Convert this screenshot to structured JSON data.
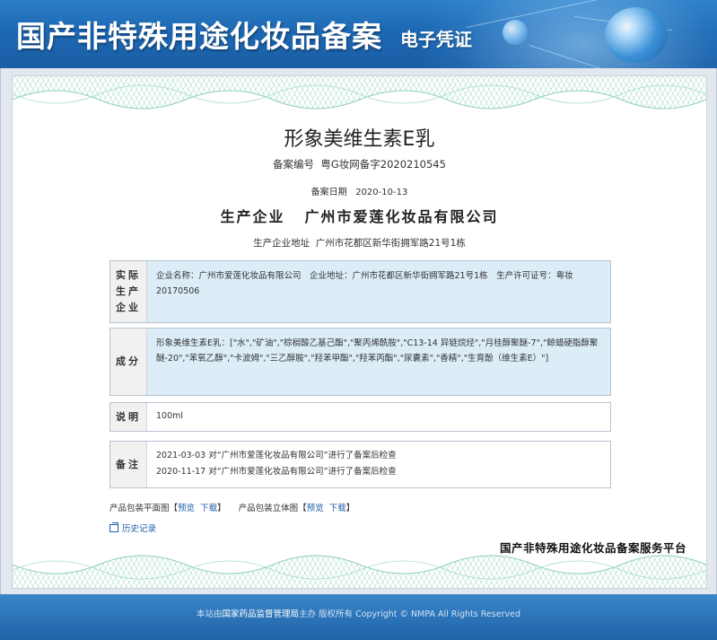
{
  "header": {
    "title": "国产非特殊用途化妆品备案",
    "subtitle": "电子凭证"
  },
  "certificate": {
    "product_name": "形象美维生素E乳",
    "registration_no_label": "备案编号",
    "registration_no": "粤G妆网备字2020210545",
    "registration_date_label": "备案日期",
    "registration_date": "2020-10-13",
    "manufacturer_label": "生产企业",
    "manufacturer": "广州市爱莲化妆品有限公司",
    "manufacturer_address_label": "生产企业地址",
    "manufacturer_address": "广州市花都区新华街拥军路21号1栋"
  },
  "sections": {
    "actual_producer": {
      "label": "实际生产企业",
      "label_lines": [
        "实际",
        "生产",
        "企业"
      ],
      "content": "企业名称：广州市爱莲化妆品有限公司　企业地址：广州市花都区新华街拥军路21号1栋　生产许可证号：粤妆20170506"
    },
    "ingredients": {
      "label": "成分",
      "content": "形象美维生素E乳：[\"水\",\"矿油\",\"棕榈酸乙基己酯\",\"聚丙烯酰胺\",\"C13-14 异链烷烃\",\"月桂醇聚醚-7\",\"鲸蜡硬脂醇聚醚-20\",\"苯氧乙醇\",\"卡波姆\",\"三乙醇胺\",\"羟苯甲酯\",\"羟苯丙酯\",\"尿囊素\",\"香精\",\"生育酚（维生素E）\"]"
    },
    "description": {
      "label": "说明",
      "content": "100ml"
    },
    "notes": {
      "label": "备注",
      "lines": [
        "2021-03-03 对“广州市爱莲化妆品有限公司”进行了备案后检查",
        "2020-11-17 对“广州市爱莲化妆品有限公司”进行了备案后检查"
      ]
    }
  },
  "links": {
    "package_flat_label": "产品包装平面图",
    "package_3d_label": "产品包装立体图",
    "preview": "预览",
    "download": "下载",
    "bracket_open": "【",
    "bracket_close": "】",
    "history": "历史记录"
  },
  "platform_name": "国产非特殊用途化妆品备案服务平台",
  "footer": {
    "prefix": "本站由",
    "org": "国家药品监督管理局",
    "suffix": "主办 版权所有 Copyright © NMPA All Rights Reserved"
  },
  "colors": {
    "header_blue": "#1d68b3",
    "link_blue": "#1f5fa8",
    "section_bg": "#dcedf8"
  }
}
